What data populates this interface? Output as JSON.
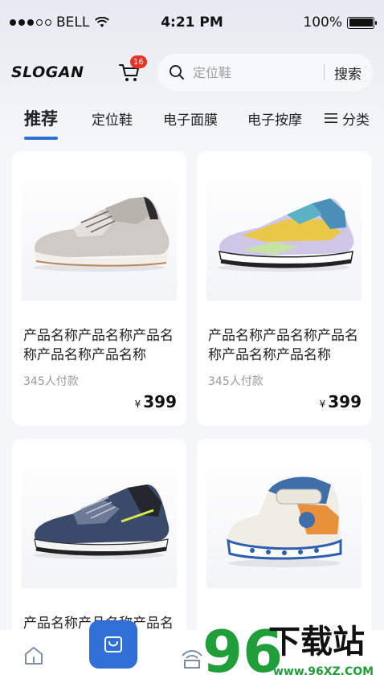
{
  "status_bar": {
    "carrier": "BELL",
    "time": "4:21 PM",
    "battery": "100%",
    "battery_level": 1.0
  },
  "header": {
    "logo": "SLOGAN",
    "cart_badge": "16",
    "search": {
      "placeholder": "定位鞋",
      "button_label": "搜索"
    }
  },
  "tabs": [
    {
      "label": "推荐",
      "active": true
    },
    {
      "label": "定位鞋",
      "active": false
    },
    {
      "label": "电子面膜",
      "active": false
    },
    {
      "label": "电子按摩",
      "active": false
    },
    {
      "label": "分类",
      "active": false,
      "icon": "menu-icon"
    }
  ],
  "products": [
    {
      "title": "产品名称产品名称产品名称产品名称产品名称",
      "sales": "345人付款",
      "currency": "¥",
      "price": "399"
    },
    {
      "title": "产品名称产品名称产品名称产品名称产品名称",
      "sales": "345人付款",
      "currency": "¥",
      "price": "399"
    },
    {
      "title": "产品名称产品名称产品名称",
      "sales": "",
      "currency": "",
      "price": ""
    },
    {
      "title": "",
      "sales": "",
      "currency": "",
      "price": ""
    }
  ],
  "bottom_nav": {
    "items": [
      {
        "icon": "home-icon"
      },
      {
        "icon": "shopping-bag-icon"
      },
      {
        "icon": "store-icon"
      }
    ]
  },
  "watermark": {
    "brand": "96",
    "text": "下载站",
    "url": "www.96XZ.COM"
  },
  "colors": {
    "accent": "#2f6fd6",
    "badge": "#e8332b",
    "watermark_green": "#1f9e3a"
  }
}
